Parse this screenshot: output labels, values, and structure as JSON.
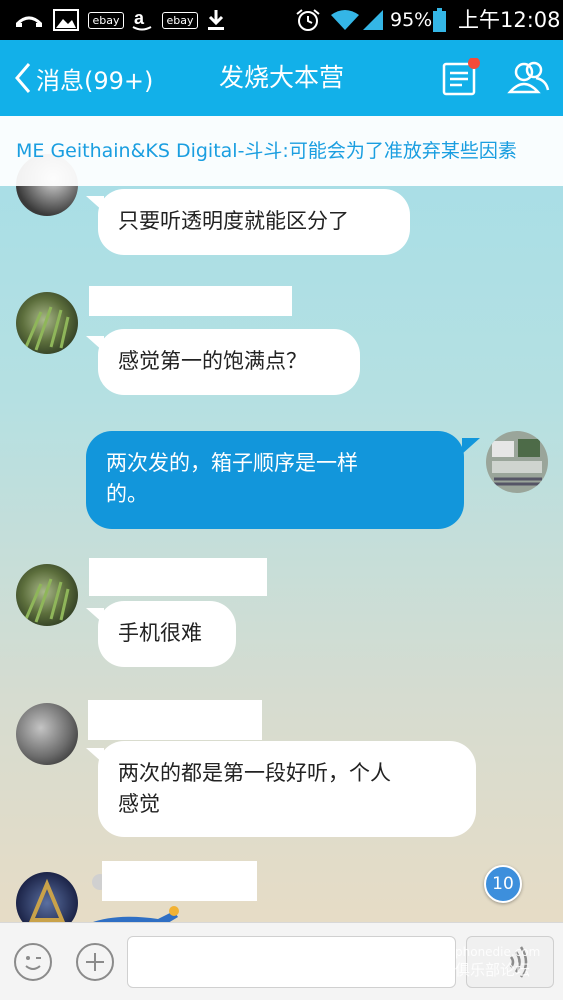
{
  "status_bar": {
    "icons": [
      "missed-call-icon",
      "image-icon",
      "ebay-icon",
      "amazon-icon",
      "ebay-icon",
      "download-icon",
      "alarm-icon",
      "wifi-icon",
      "signal-icon",
      "battery-icon"
    ],
    "ebay_label": "ebay",
    "battery": "95%",
    "time": "上午12:08"
  },
  "title_bar": {
    "back_label": "消息(99+)",
    "title": "发烧大本营",
    "icons": [
      "announcement-icon",
      "group-members-icon"
    ],
    "accent": "#12b0e9"
  },
  "notice": {
    "text": "ME Geithain&KS Digital-斗斗:可能会为了准放弃某些因素"
  },
  "messages": [
    {
      "sender": "other",
      "text": "只要听透明度就能区分了"
    },
    {
      "sender": "other",
      "text": "感觉第一的饱满点？"
    },
    {
      "sender": "self",
      "line1": "两次发的，箱子顺序是一样",
      "line2": "的。"
    },
    {
      "sender": "other",
      "text": "手机很难"
    },
    {
      "sender": "other",
      "line1": "两次的都是第一段好听，个人",
      "line2": "感觉"
    }
  ],
  "unread_badge": "10",
  "bottom_bar": {
    "icons": [
      "emoji-icon",
      "plus-icon",
      "voice-icon"
    ],
    "input_placeholder": ""
  },
  "watermark": {
    "line1": "phonedie.com",
    "line2": "俱乐部论坛"
  }
}
